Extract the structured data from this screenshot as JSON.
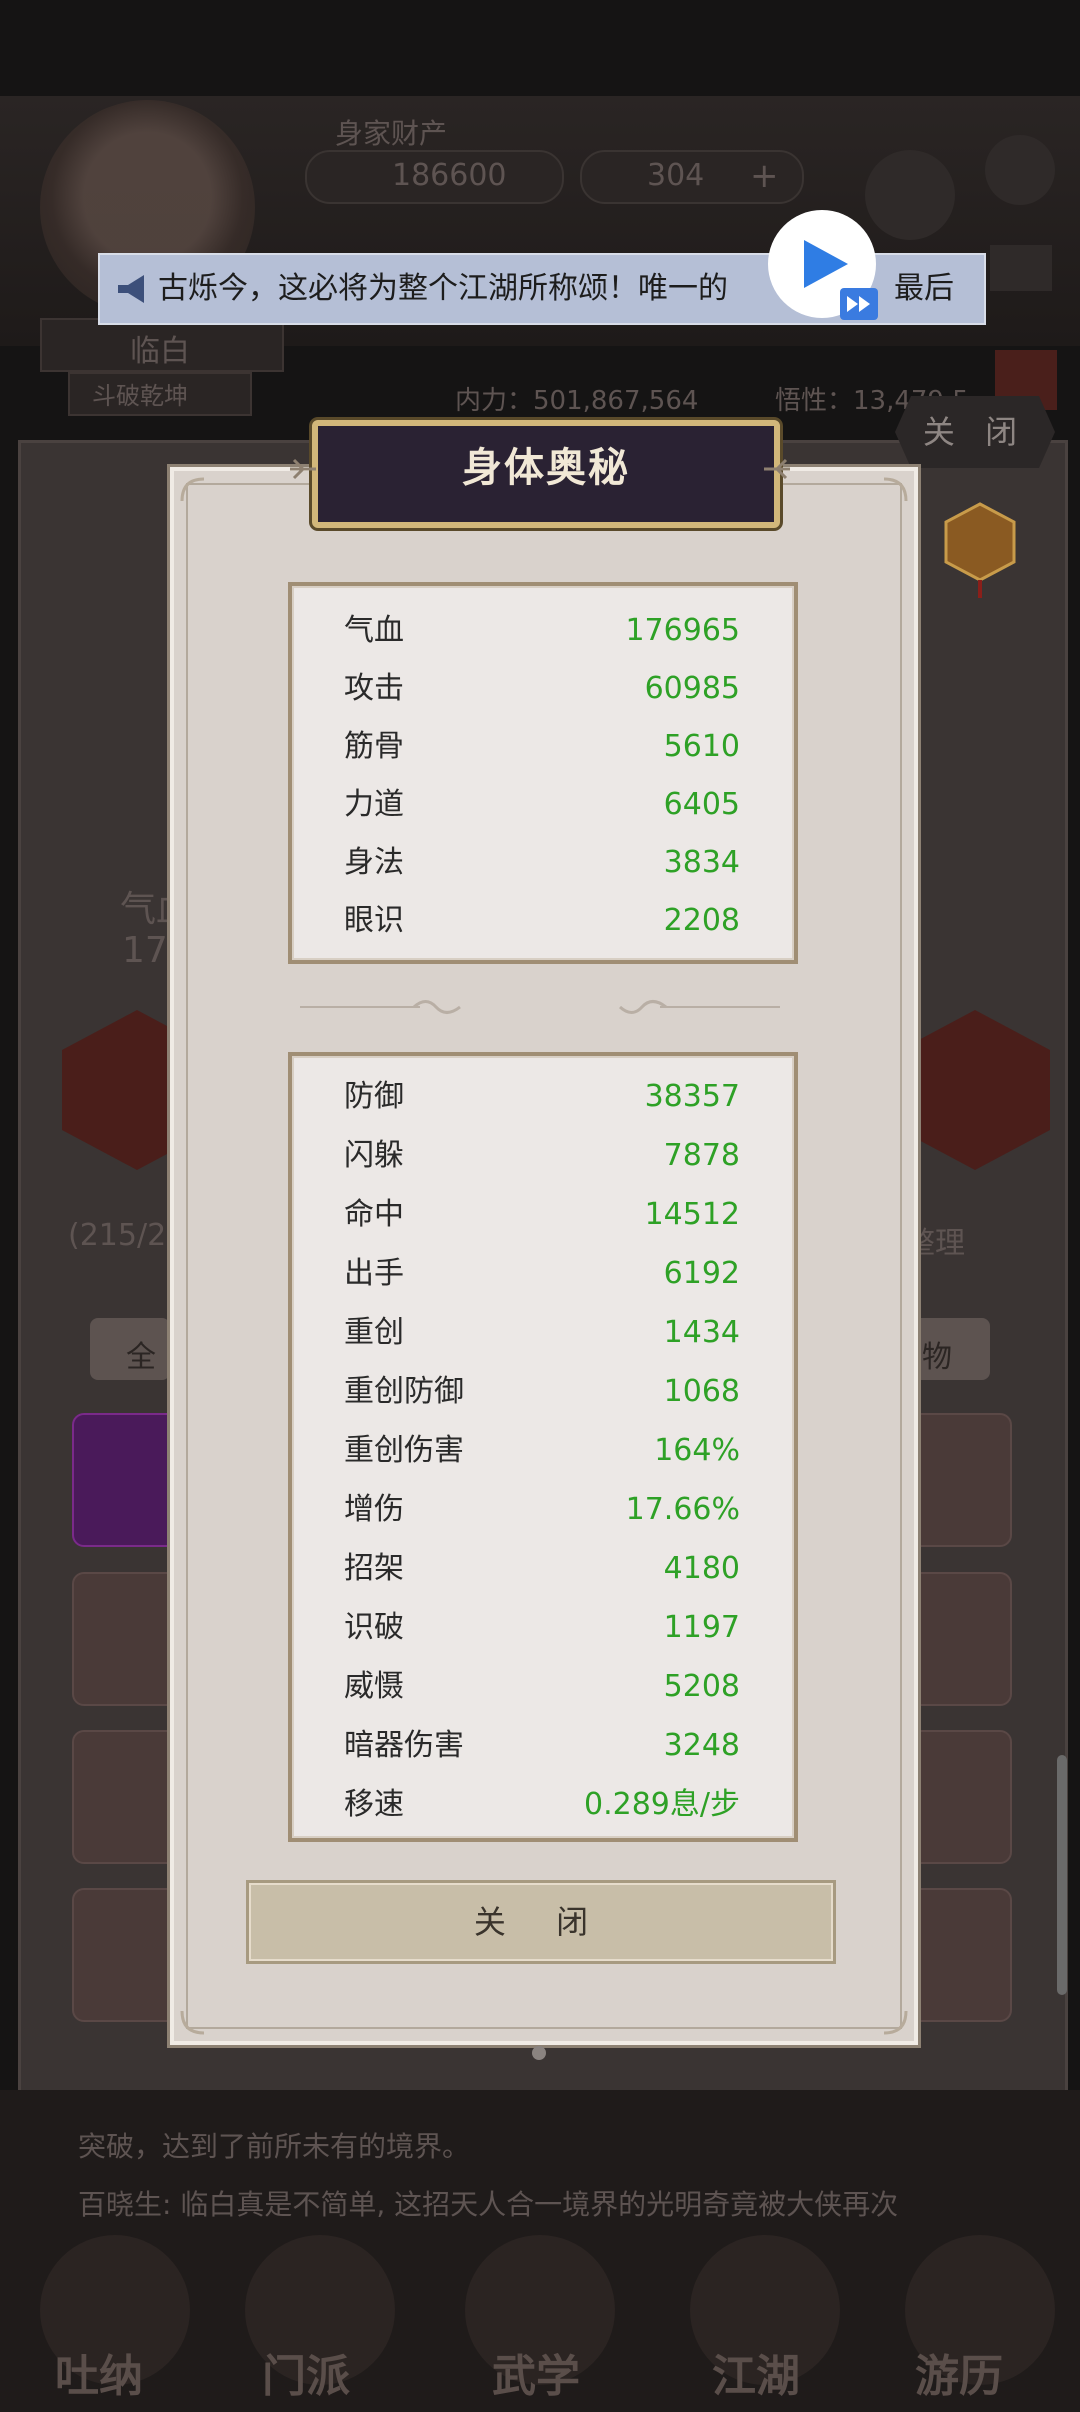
{
  "header": {
    "assets_label": "身家财产",
    "gold_amount": "186600",
    "gem_amount": "304",
    "player_name": "临白",
    "player_title": "斗破乾坤",
    "power_line": "内力：501,867,564",
    "stat_line": "悟性：13,479,5..."
  },
  "announcement": {
    "text": "古烁今，这必将为整个江湖所称颂！唯一的",
    "text_end": "最后"
  },
  "background_close_label": "关 闭",
  "background_side": {
    "left_label": "气血",
    "left_value": "176",
    "progress": "(215/24",
    "arrange_label": "整理",
    "tab_all": "全",
    "tab_item": "物"
  },
  "chat": {
    "line1": "突破，达到了前所未有的境界。",
    "line2": "百晓生: 临白真是不简单, 这招天人合一境界的光明奇竟被大侠再次"
  },
  "bottom_nav": [
    {
      "label": "吐纳"
    },
    {
      "label": "门派"
    },
    {
      "label": "武学"
    },
    {
      "label": "江湖"
    },
    {
      "label": "游历"
    }
  ],
  "dialog": {
    "title": "身体奥秘",
    "close_label": "关 闭",
    "basic_stats": [
      {
        "label": "气血",
        "value": "176965"
      },
      {
        "label": "攻击",
        "value": "60985"
      },
      {
        "label": "筋骨",
        "value": "5610"
      },
      {
        "label": "力道",
        "value": "6405"
      },
      {
        "label": "身法",
        "value": "3834"
      },
      {
        "label": "眼识",
        "value": "2208"
      }
    ],
    "advanced_stats": [
      {
        "label": "防御",
        "value": "38357"
      },
      {
        "label": "闪躲",
        "value": "7878"
      },
      {
        "label": "命中",
        "value": "14512"
      },
      {
        "label": "出手",
        "value": "6192"
      },
      {
        "label": "重创",
        "value": "1434"
      },
      {
        "label": "重创防御",
        "value": "1068"
      },
      {
        "label": "重创伤害",
        "value": "164%"
      },
      {
        "label": "增伤",
        "value": "17.66%"
      },
      {
        "label": "招架",
        "value": "4180"
      },
      {
        "label": "识破",
        "value": "1197"
      },
      {
        "label": "威慑",
        "value": "5208"
      },
      {
        "label": "暗器伤害",
        "value": "3248"
      },
      {
        "label": "移速",
        "value": "0.289息/步"
      }
    ]
  },
  "colors": {
    "stat_value": "#2ea126",
    "title_plate": "#2a2233",
    "dialog_bg": "#d9d2cc"
  }
}
